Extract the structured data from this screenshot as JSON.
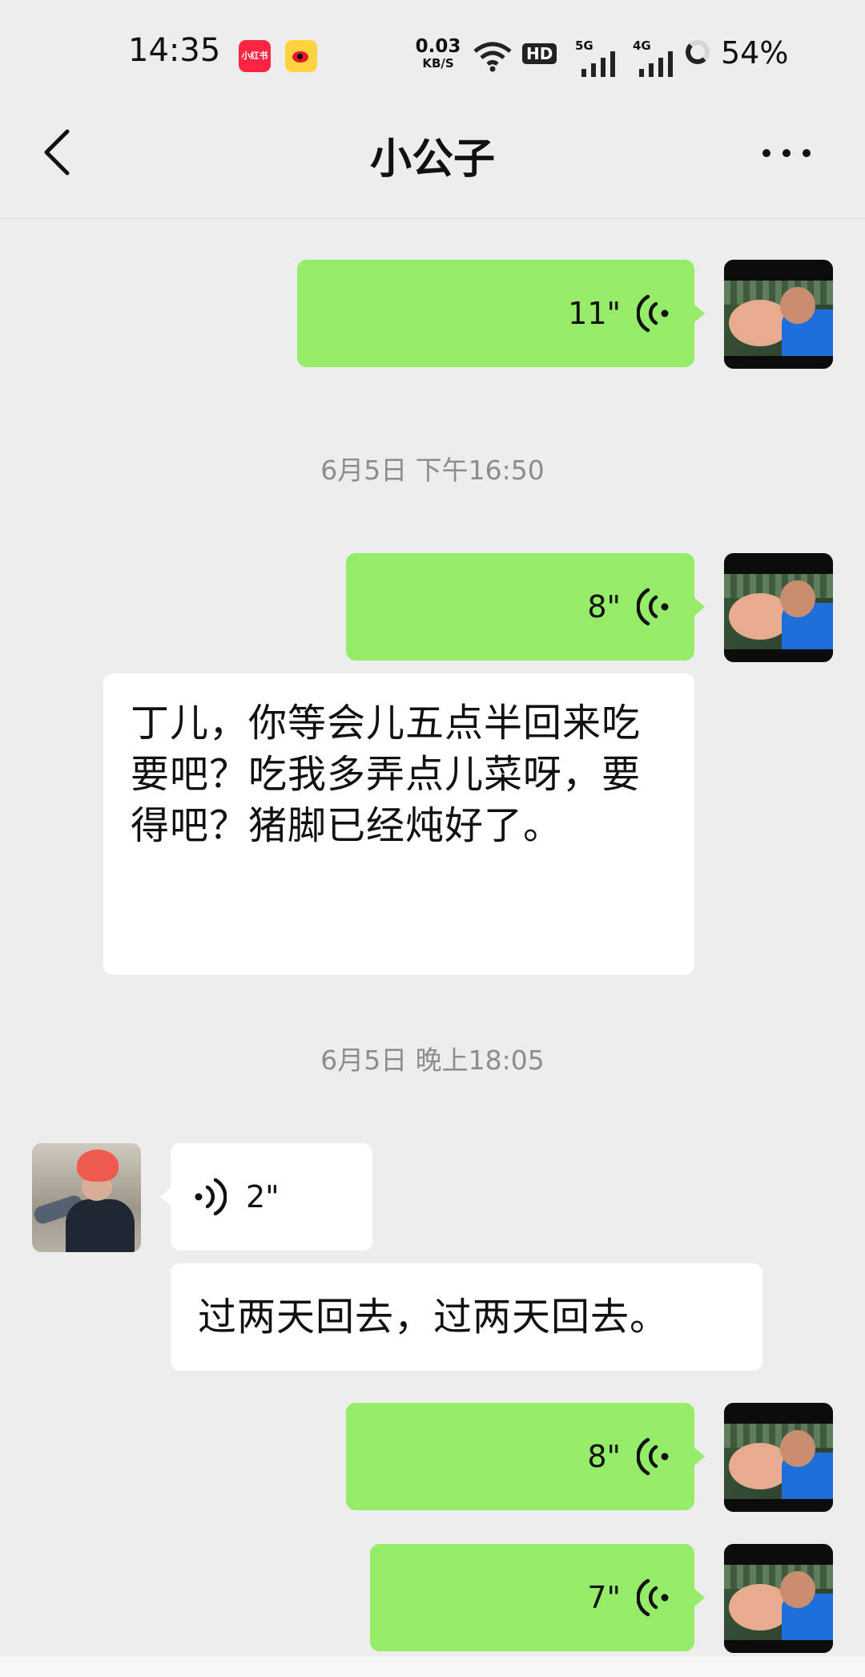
{
  "status_bar": {
    "time": "14:35",
    "xhs_label": "小红书",
    "net_speed_value": "0.03",
    "net_speed_unit": "KB/S",
    "hd_label": "HD",
    "signal_1_label": "5G",
    "signal_2_label": "4G",
    "battery": "54%"
  },
  "header": {
    "title": "小公子"
  },
  "messages": [
    {
      "sender": "me",
      "type": "voice",
      "duration": "11\""
    },
    {
      "type": "timestamp",
      "text": "6月5日  下午16:50"
    },
    {
      "sender": "me",
      "type": "voice",
      "duration": "8\""
    },
    {
      "sender": "me",
      "type": "text",
      "text": "丁儿，你等会儿五点半回来吃要吧？吃我多弄点儿菜呀，要得吧？猪脚已经炖好了。"
    },
    {
      "type": "timestamp",
      "text": "6月5日  晚上18:05"
    },
    {
      "sender": "them",
      "type": "voice",
      "duration": "2\""
    },
    {
      "sender": "them",
      "type": "text",
      "text": "过两天回去，过两天回去。"
    },
    {
      "sender": "me",
      "type": "voice",
      "duration": "8\""
    },
    {
      "sender": "me",
      "type": "voice",
      "duration": "7\""
    }
  ],
  "colors": {
    "background": "#ededed",
    "my_bubble": "#95ec69",
    "their_bubble": "#ffffff",
    "timestamp_text": "#8d8d8d"
  },
  "icons": [
    "back-icon",
    "more-icon",
    "voice-icon",
    "wifi-icon",
    "xiaohongshu-icon",
    "weibo-icon"
  ]
}
